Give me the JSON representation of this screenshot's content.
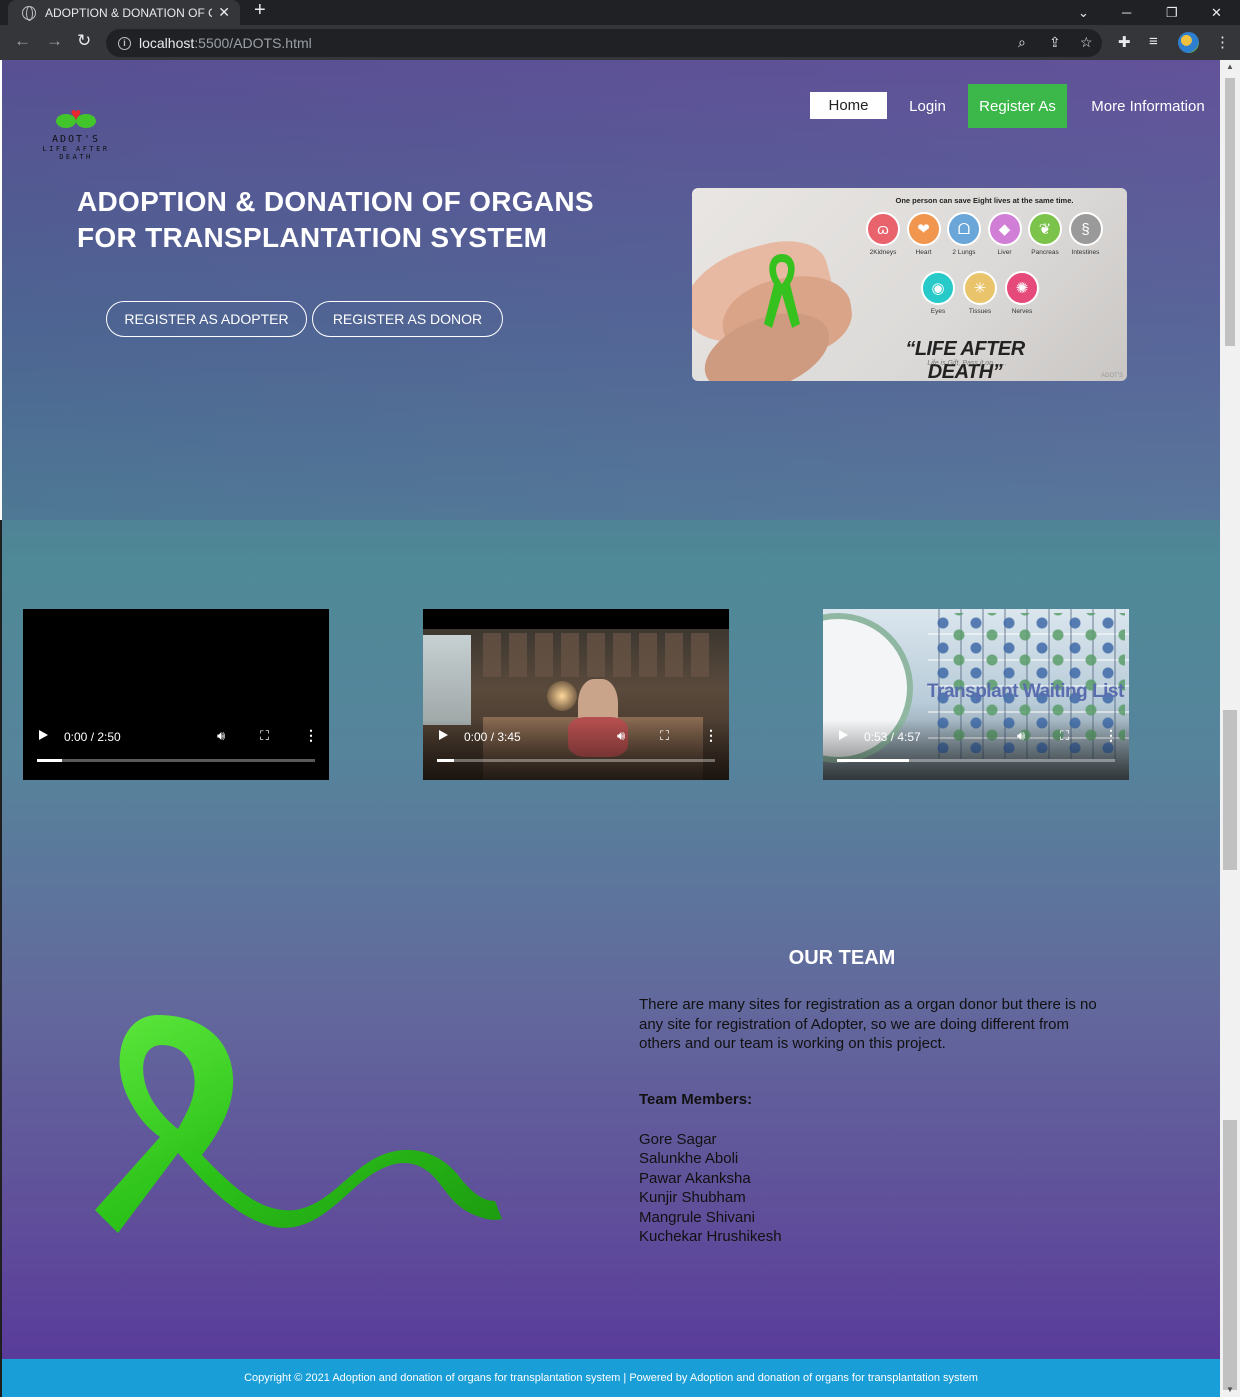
{
  "browser": {
    "tab_title": "ADOPTION & DONATION OF OR",
    "tab_close": "✕",
    "new_tab": "+",
    "url_host": "localhost",
    "url_path": ":5500/ADOTS.html"
  },
  "logo": {
    "name": "ADOT'S",
    "tagline": "LIFE AFTER DEATH"
  },
  "nav": {
    "home": "Home",
    "login": "Login",
    "register": "Register As",
    "more": "More Information"
  },
  "hero": {
    "title_line1": "ADOPTION & DONATION OF ORGANS",
    "title_line2": "FOR TRANSPLANTATION SYSTEM",
    "btn_adopter": "REGISTER AS ADOPTER",
    "btn_donor": "REGISTER AS DONOR"
  },
  "hero_image": {
    "heading": "One person can save Eight lives at the same time.",
    "organs": [
      "2Kidneys",
      "Heart",
      "2 Lungs",
      "Liver",
      "Pancreas",
      "Intestines",
      "Eyes",
      "Tissues",
      "Nerves"
    ],
    "organ_colors": [
      "#e9636d",
      "#f0964e",
      "#6aa7d8",
      "#d17fd6",
      "#7bc34b",
      "#9a9a9a",
      "#28c9c9",
      "#e9c46a",
      "#e64a7b"
    ],
    "slogan": "“LIFE AFTER DEATH”",
    "sub": "Life is Gift, Pass it on.......",
    "brand": "ADOT'S"
  },
  "videos": [
    {
      "time": "0:00 / 2:50",
      "progress": 0.09
    },
    {
      "time": "0:00 / 3:45",
      "progress": 0.06
    },
    {
      "time": "0:53 / 4:57",
      "progress": 0.26
    }
  ],
  "video3_overlay": "Transplant Waiting List",
  "team": {
    "title": "OUR TEAM",
    "description": "There are many sites for registration as a organ donor but there is no any site for registration of Adopter, so we are doing different from others and our team is working on this project.",
    "members_label": "Team Members:",
    "members": [
      "Gore Sagar",
      "Salunkhe Aboli",
      "Pawar Akanksha",
      "Kunjir Shubham",
      "Mangrule Shivani",
      "Kuchekar Hrushikesh"
    ]
  },
  "footer": "Copyright © 2021 Adoption and donation of organs for transplantation system  |  Powered by Adoption and donation of organs for transplantation system",
  "colors": {
    "register_green": "#3cb84a",
    "footer_blue": "#1a9ed7",
    "ribbon_green": "#2fc41a"
  }
}
